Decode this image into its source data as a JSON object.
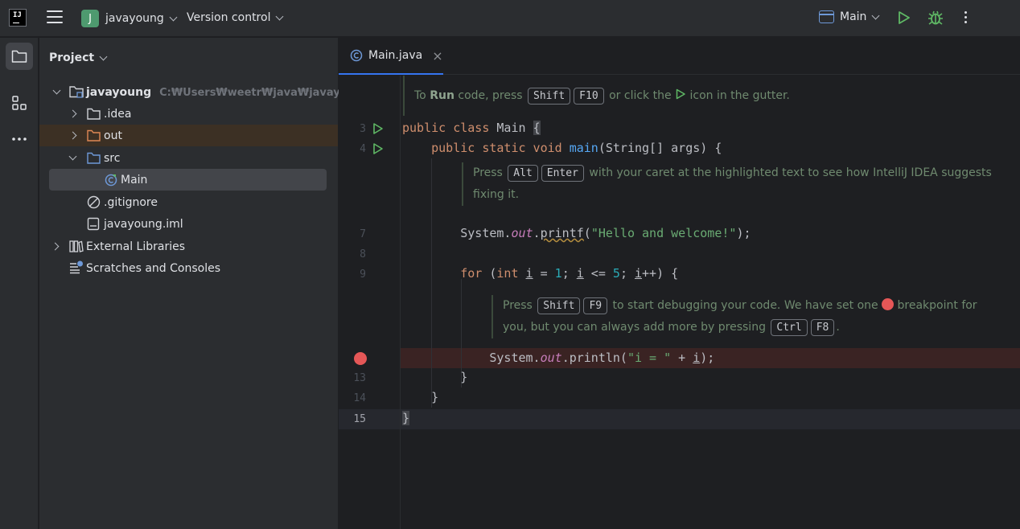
{
  "titlebar": {
    "logo": "IJ",
    "project_badge": "J",
    "project_name": "javayoung",
    "vcs_label": "Version control",
    "run_config": "Main"
  },
  "project_panel": {
    "title": "Project",
    "tree": [
      {
        "label": "javayoung",
        "hint": "C:₩Users₩weetr₩java₩javayoung"
      },
      {
        "label": ".idea"
      },
      {
        "label": "out"
      },
      {
        "label": "src"
      },
      {
        "label": "Main"
      },
      {
        "label": ".gitignore"
      },
      {
        "label": "javayoung.iml"
      },
      {
        "label": "External Libraries"
      },
      {
        "label": "Scratches and Consoles"
      }
    ]
  },
  "editor": {
    "tab": "Main.java",
    "line_numbers": [
      "3",
      "4",
      "7",
      "8",
      "9",
      "13",
      "14",
      "15"
    ],
    "doc1": {
      "pre": "To ",
      "bold": "Run",
      "mid": " code, press ",
      "k1": "Shift",
      "k2": "F10",
      "post1": " or click the ",
      "post2": " icon in the gutter."
    },
    "doc2": {
      "pre": "Press ",
      "k1": "Alt",
      "k2": "Enter",
      "post": " with your caret at the highlighted text to see how IntelliJ IDEA suggests",
      "line2": "fixing it."
    },
    "doc3": {
      "pre": "Press ",
      "k1": "Shift",
      "k2": "F9",
      "post": " to start debugging your code. We have set one ",
      "post2": " breakpoint for",
      "line2": "you, but you can always add more by pressing ",
      "k3": "Ctrl",
      "k4": "F8",
      "end": "."
    },
    "code": {
      "l3_kw": "public class ",
      "l3_name": "Main ",
      "l3_brace": "{",
      "l4_kw": "public static void ",
      "l4_fn": "main",
      "l4_rest": "(String[] args) {",
      "l7_a": "System.",
      "l7_out": "out",
      "l7_dot": ".",
      "l7_fn": "printf",
      "l7_p": "(",
      "l7_str": "\"Hello and welcome!\"",
      "l7_end": ");",
      "l9_kw": "for ",
      "l9_a": "(",
      "l9_int": "int ",
      "l9_i1": "i",
      "l9_b": " = ",
      "l9_n1": "1",
      "l9_c": "; ",
      "l9_i2": "i",
      "l9_d": " <= ",
      "l9_n2": "5",
      "l9_e": "; ",
      "l9_i3": "i",
      "l9_f": "++) {",
      "l12_a": "System.",
      "l12_out": "out",
      "l12_b": ".println(",
      "l12_str": "\"i = \"",
      "l12_c": " + ",
      "l12_i": "i",
      "l12_d": ");",
      "l13": "}",
      "l14": "}",
      "l15": "}"
    }
  }
}
